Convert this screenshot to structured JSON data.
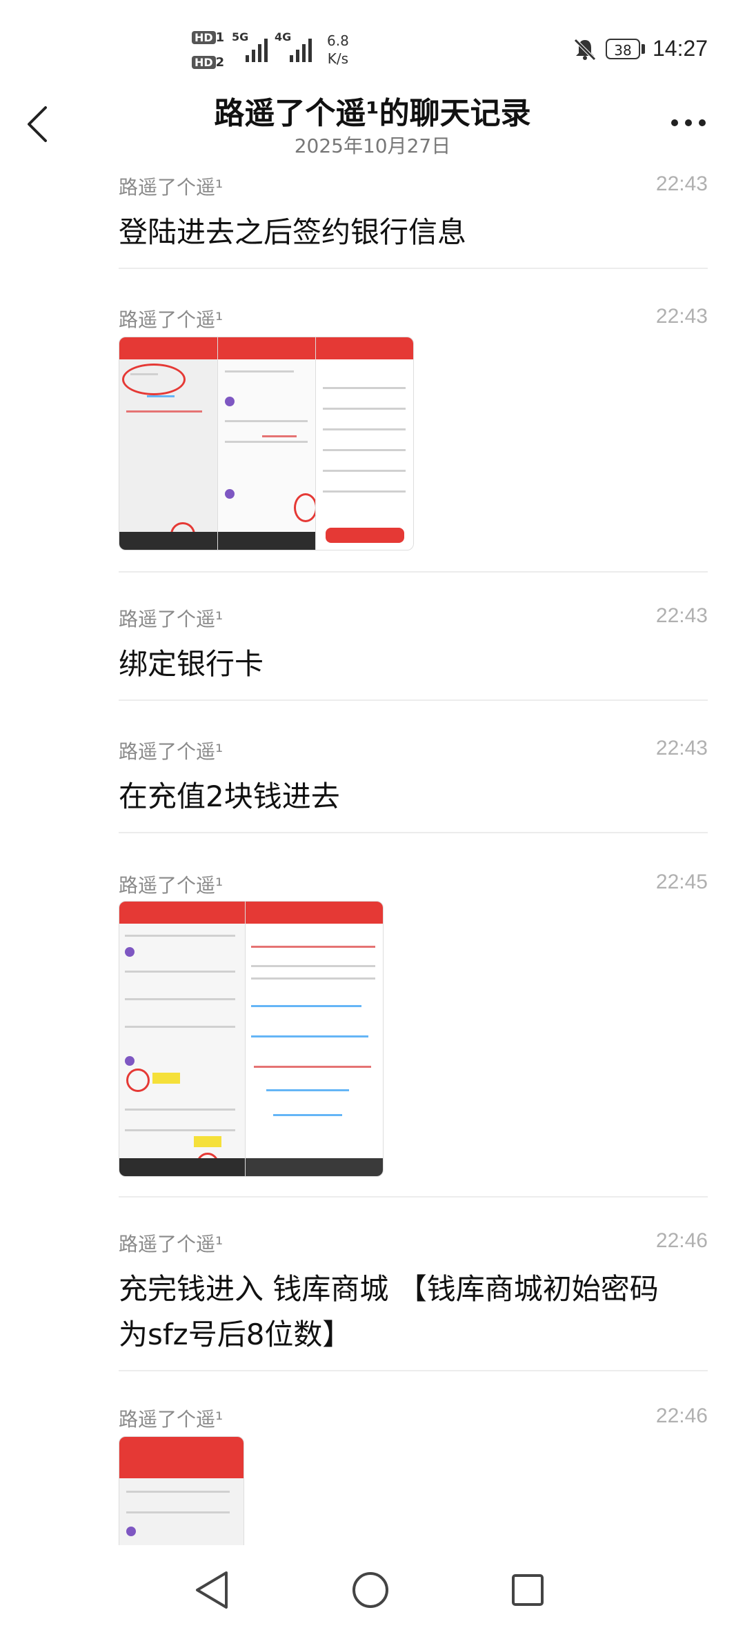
{
  "status_bar": {
    "hd1": "HD",
    "hd1_sub": "1",
    "hd2": "HD",
    "hd2_sub": "2",
    "net1": "5G",
    "net2": "4G",
    "speed_value": "6.8",
    "speed_unit": "K/s",
    "battery": "38",
    "time": "14:27"
  },
  "header": {
    "title": "路遥了个遥¹的聊天记录",
    "date": "2025年10月27日"
  },
  "messages": [
    {
      "sender": "路遥了个遥¹",
      "time": "22:43",
      "text": "登陆进去之后签约银行信息"
    },
    {
      "sender": "路遥了个遥¹",
      "time": "22:43",
      "image": "screenshot-bank-signing"
    },
    {
      "sender": "路遥了个遥¹",
      "time": "22:43",
      "text": "绑定银行卡"
    },
    {
      "sender": "路遥了个遥¹",
      "time": "22:43",
      "text": "在充值2块钱进去"
    },
    {
      "sender": "路遥了个遥¹",
      "time": "22:45",
      "image": "screenshot-recharge"
    },
    {
      "sender": "路遥了个遥¹",
      "time": "22:46",
      "text_line1": "充完钱进入 钱库商城 【钱库商城初始密码",
      "text_line2": "为sfz号后8位数】"
    },
    {
      "sender": "路遥了个遥¹",
      "time": "22:46",
      "image": "screenshot-app"
    }
  ],
  "colors": {
    "accent_red": "#e53935",
    "text_gray": "#8a8a8a",
    "time_gray": "#b0b0b0"
  }
}
